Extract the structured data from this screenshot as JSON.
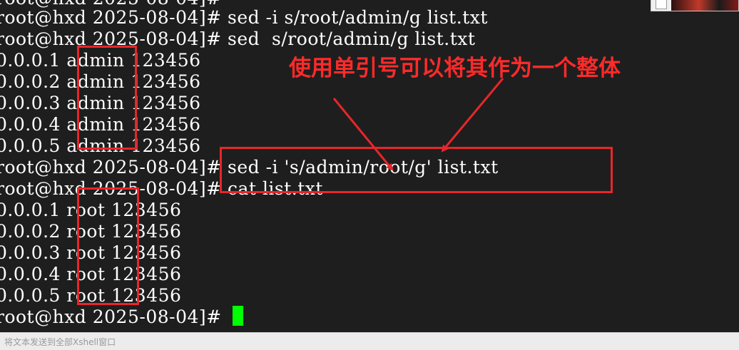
{
  "terminal": {
    "lines": [
      "root@hxd 2025-08-04]# ",
      "root@hxd 2025-08-04]# sed -i s/root/admin/g list.txt",
      "root@hxd 2025-08-04]# sed  s/root/admin/g list.txt",
      "0.0.0.1 admin 123456",
      "0.0.0.2 admin 123456",
      "0.0.0.3 admin 123456",
      "0.0.0.4 admin 123456",
      "0.0.0.5 admin 123456",
      "root@hxd 2025-08-04]# sed -i 's/admin/root/g' list.txt",
      "root@hxd 2025-08-04]# cat list.txt",
      "0.0.0.1 root 123456",
      "0.0.0.2 root 123456",
      "0.0.0.3 root 123456",
      "0.0.0.4 root 123456",
      "0.0.0.5 root 123456",
      "root@hxd 2025-08-04]# "
    ],
    "colors": {
      "background": "#1e1e1e",
      "text": "#ffffff",
      "cursor": "#00ff00",
      "annotation": "#e8262a"
    }
  },
  "annotation": {
    "text": "使用单引号可以将其作为一个整体"
  },
  "statusbar": {
    "placeholder": "将文本发送到全部Xshell窗口"
  }
}
